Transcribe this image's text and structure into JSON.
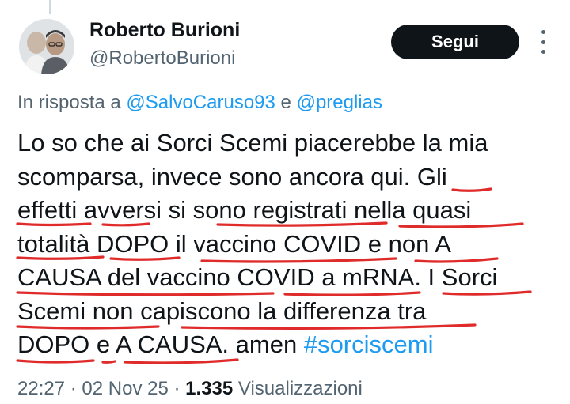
{
  "author": {
    "name": "Roberto Burioni",
    "handle": "@RobertoBurioni",
    "follow_label": "Segui"
  },
  "reply": {
    "prefix": "In risposta a",
    "mention1": "@SalvoCaruso93",
    "conjunction": "e",
    "mention2": "@preglias"
  },
  "tweet": {
    "lines": [
      "Lo so che ai Sorci Scemi piacerebbe la mia",
      "scomparsa, invece sono ancora qui. Gli",
      "effetti avversi si sono registrati nella quasi",
      "totalità DOPO il vaccino COVID e non A",
      "CAUSA del vaccino COVID a mRNA. I Sorci",
      "Scemi non capiscono la differenza tra",
      "DOPO e A CAUSA. amen"
    ],
    "hashtag": "#sorciscemi"
  },
  "meta": {
    "time": "22:27",
    "date": "02 Nov 25",
    "separator": "·",
    "views_count": "1.335",
    "views_label": "Visualizzazioni"
  },
  "colors": {
    "link": "#1d9bf0",
    "annotation": "#e02b2b",
    "button_bg": "#0f1419",
    "secondary_text": "#536471"
  },
  "icons": [
    "more-options-icon"
  ]
}
